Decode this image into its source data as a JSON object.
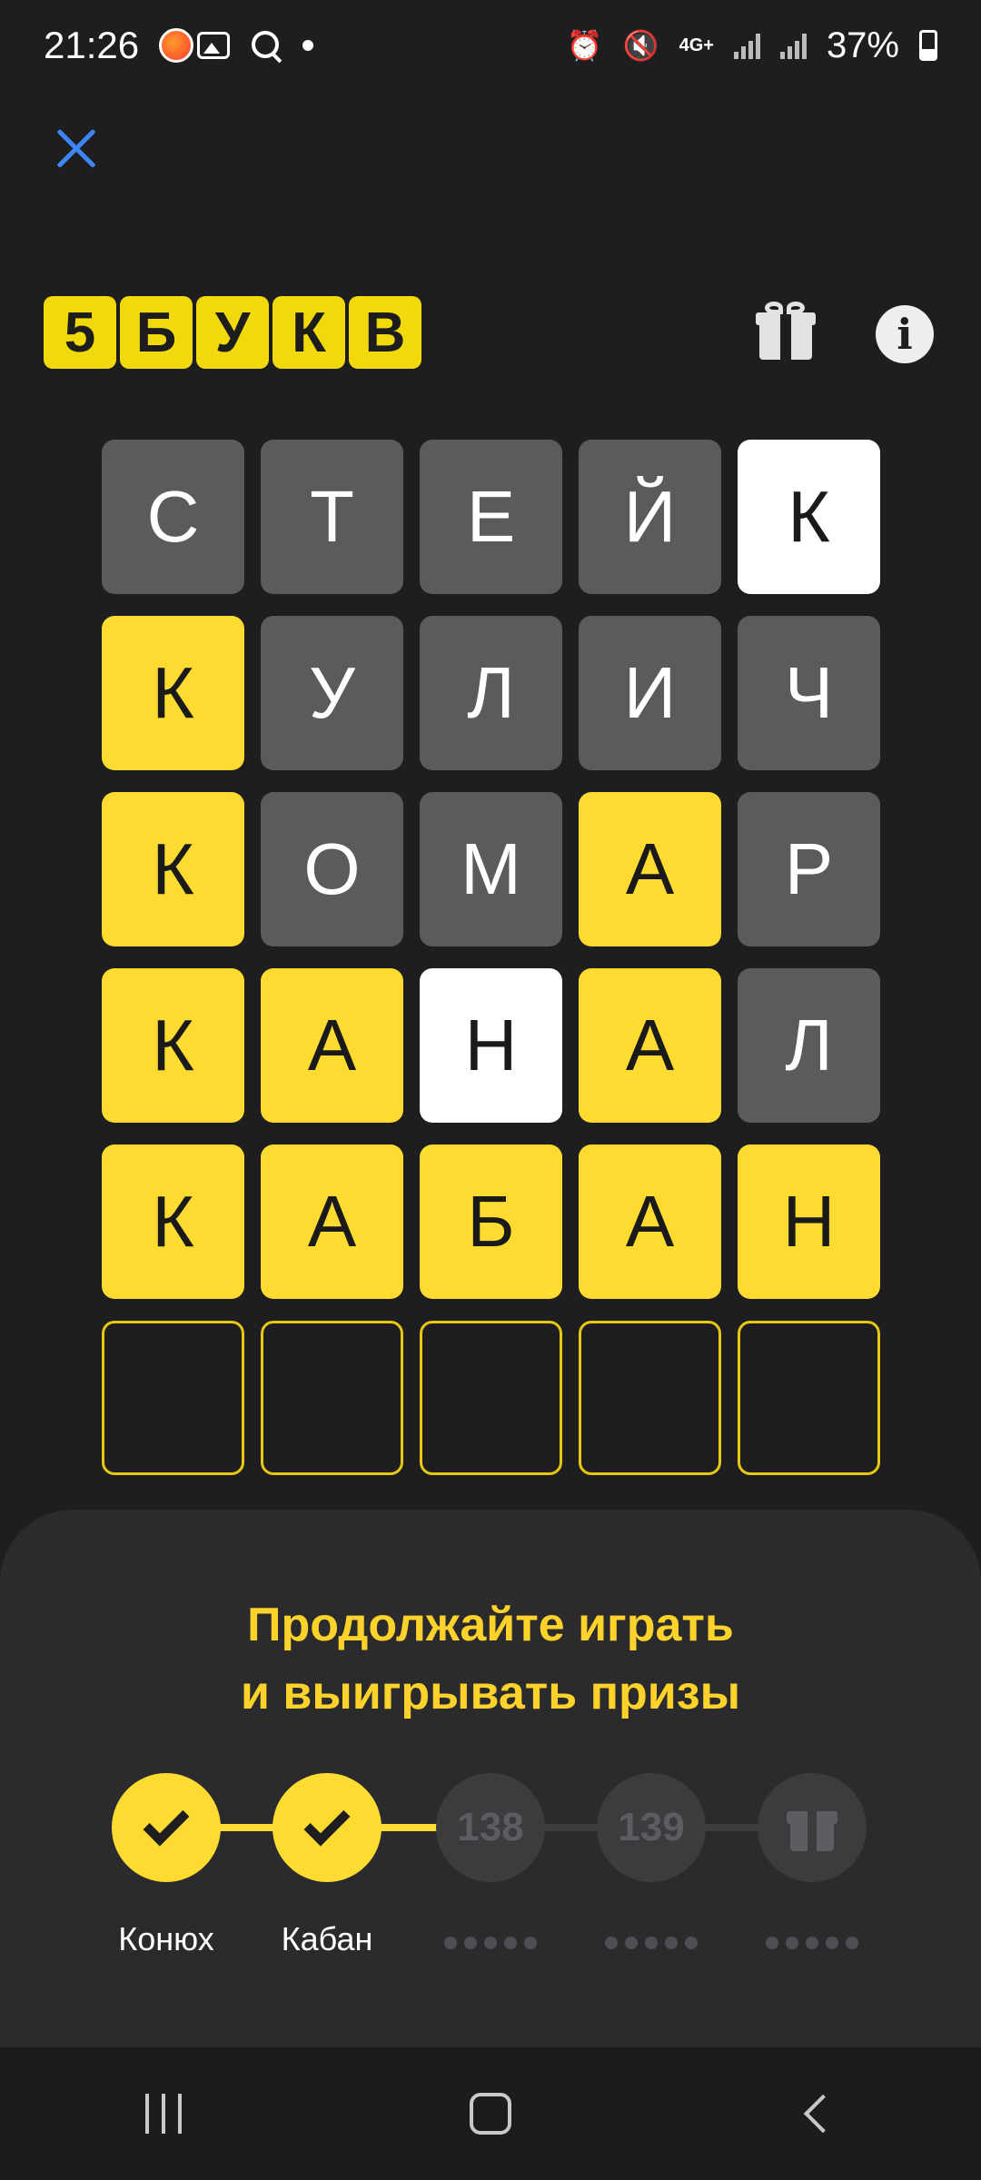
{
  "status_bar": {
    "time": "21:26",
    "network": "4G+",
    "battery_percent": "37%",
    "battery_level": 0.37,
    "icons": [
      "app-notification-icon",
      "gallery-icon",
      "search-icon",
      "dot-icon",
      "alarm-icon",
      "mute-icon",
      "network-4g-icon",
      "signal-icon",
      "signal-icon",
      "battery-icon"
    ]
  },
  "header": {
    "close_icon": "close-icon",
    "logo_letters": [
      "5",
      "Б",
      "У",
      "К",
      "В"
    ],
    "gift_icon": "gift-icon",
    "info_icon": "info-icon",
    "info_glyph": "i"
  },
  "board": {
    "rows": [
      [
        {
          "letter": "С",
          "state": "absent"
        },
        {
          "letter": "Т",
          "state": "absent"
        },
        {
          "letter": "Е",
          "state": "absent"
        },
        {
          "letter": "Й",
          "state": "absent"
        },
        {
          "letter": "К",
          "state": "present"
        }
      ],
      [
        {
          "letter": "К",
          "state": "correct"
        },
        {
          "letter": "У",
          "state": "absent"
        },
        {
          "letter": "Л",
          "state": "absent"
        },
        {
          "letter": "И",
          "state": "absent"
        },
        {
          "letter": "Ч",
          "state": "absent"
        }
      ],
      [
        {
          "letter": "К",
          "state": "correct"
        },
        {
          "letter": "О",
          "state": "absent"
        },
        {
          "letter": "М",
          "state": "absent"
        },
        {
          "letter": "А",
          "state": "correct"
        },
        {
          "letter": "Р",
          "state": "absent"
        }
      ],
      [
        {
          "letter": "К",
          "state": "correct"
        },
        {
          "letter": "А",
          "state": "correct"
        },
        {
          "letter": "Н",
          "state": "present"
        },
        {
          "letter": "А",
          "state": "correct"
        },
        {
          "letter": "Л",
          "state": "absent"
        }
      ],
      [
        {
          "letter": "К",
          "state": "correct"
        },
        {
          "letter": "А",
          "state": "correct"
        },
        {
          "letter": "Б",
          "state": "correct"
        },
        {
          "letter": "А",
          "state": "correct"
        },
        {
          "letter": "Н",
          "state": "correct"
        }
      ],
      [
        {
          "letter": "",
          "state": "empty"
        },
        {
          "letter": "",
          "state": "empty"
        },
        {
          "letter": "",
          "state": "empty"
        },
        {
          "letter": "",
          "state": "empty"
        },
        {
          "letter": "",
          "state": "empty"
        }
      ]
    ]
  },
  "sheet": {
    "title_line1": "Продолжайте играть",
    "title_line2": "и выигрывать призы",
    "steps": [
      {
        "status": "done",
        "label": "Конюх",
        "icon": "check-icon"
      },
      {
        "status": "done",
        "label": "Кабан",
        "icon": "check-icon"
      },
      {
        "status": "locked",
        "number": "138"
      },
      {
        "status": "locked",
        "number": "139"
      },
      {
        "status": "locked",
        "icon": "gift-icon"
      }
    ]
  },
  "nav_bar": {
    "icons": [
      "recents-icon",
      "home-icon",
      "back-icon"
    ]
  },
  "colors": {
    "background": "#1e1e20",
    "accent_yellow": "#fedb31",
    "tile_absent": "#5b5b5e",
    "tile_present": "#ffffff",
    "close_blue": "#3e86f5",
    "sheet_bg": "#2b2b2e"
  }
}
